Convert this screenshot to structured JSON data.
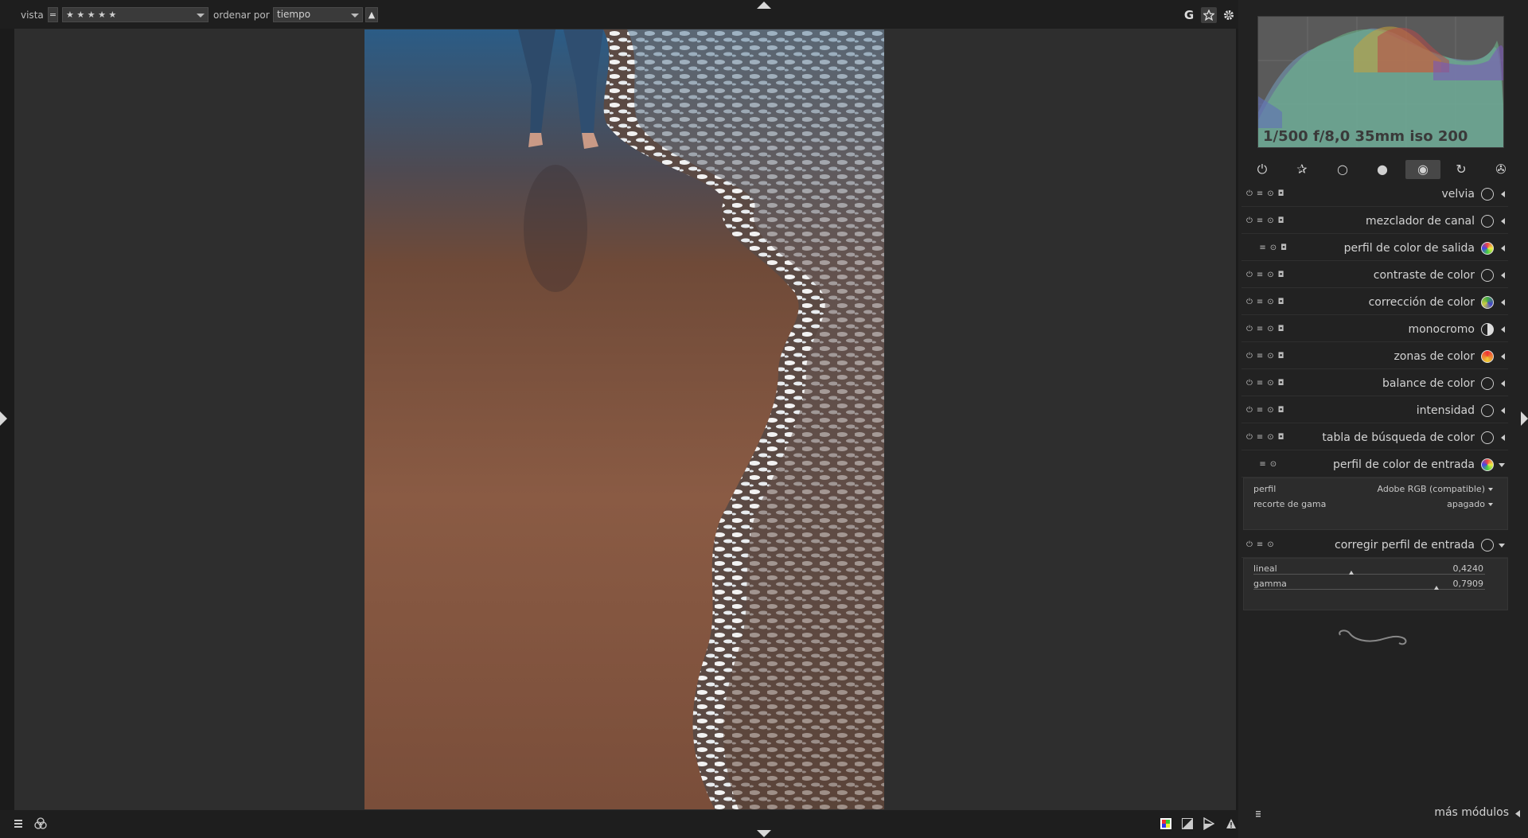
{
  "topbar": {
    "view_label": "vista",
    "view_prefix": "=",
    "view_value": "★ ★ ★ ★ ★",
    "sort_label": "ordenar por",
    "sort_value": "tiempo",
    "sort_dir": "▲",
    "right_icons": {
      "g_label": "G"
    }
  },
  "histogram": {
    "exif": "1/500 f/8,0 35mm iso 200"
  },
  "module_groups": [
    {
      "icon": "power-icon",
      "glyph": "⏻"
    },
    {
      "icon": "favorites-icon",
      "glyph": "✰"
    },
    {
      "icon": "basic-icon",
      "glyph": "○"
    },
    {
      "icon": "tone-icon",
      "glyph": "●"
    },
    {
      "icon": "color-icon",
      "glyph": "◉"
    },
    {
      "icon": "correct-icon",
      "glyph": "↻"
    },
    {
      "icon": "effect-icon",
      "glyph": "✇"
    }
  ],
  "modules": [
    {
      "name": "velvia",
      "expanded": false
    },
    {
      "name": "mezclador de canal",
      "expanded": false
    },
    {
      "name": "perfil de color de salida",
      "expanded": false
    },
    {
      "name": "contraste de color",
      "expanded": false
    },
    {
      "name": "corrección de color",
      "expanded": false
    },
    {
      "name": "monocromo",
      "expanded": false
    },
    {
      "name": "zonas de color",
      "expanded": false
    },
    {
      "name": "balance de color",
      "expanded": false
    },
    {
      "name": "intensidad",
      "expanded": false
    },
    {
      "name": "tabla de búsqueda de color",
      "expanded": false
    },
    {
      "name": "perfil de color de entrada",
      "expanded": true
    },
    {
      "name": "corregir perfil de entrada",
      "expanded": true
    }
  ],
  "input_profile": {
    "profile_label": "perfil",
    "profile_value": "Adobe RGB (compatible)",
    "gamut_label": "recorte de gama",
    "gamut_value": "apagado"
  },
  "unbreak_profile": {
    "linear_label": "lineal",
    "linear_value": "0,4240",
    "linear_level": 0.424,
    "gamma_label": "gamma",
    "gamma_value": "0,7909",
    "gamma_level": 0.7909
  },
  "more_modules": "más módulos",
  "colors": {
    "accent_bg": "#474747",
    "panel_bg": "#222222",
    "center_bg": "#2e2e2e"
  }
}
